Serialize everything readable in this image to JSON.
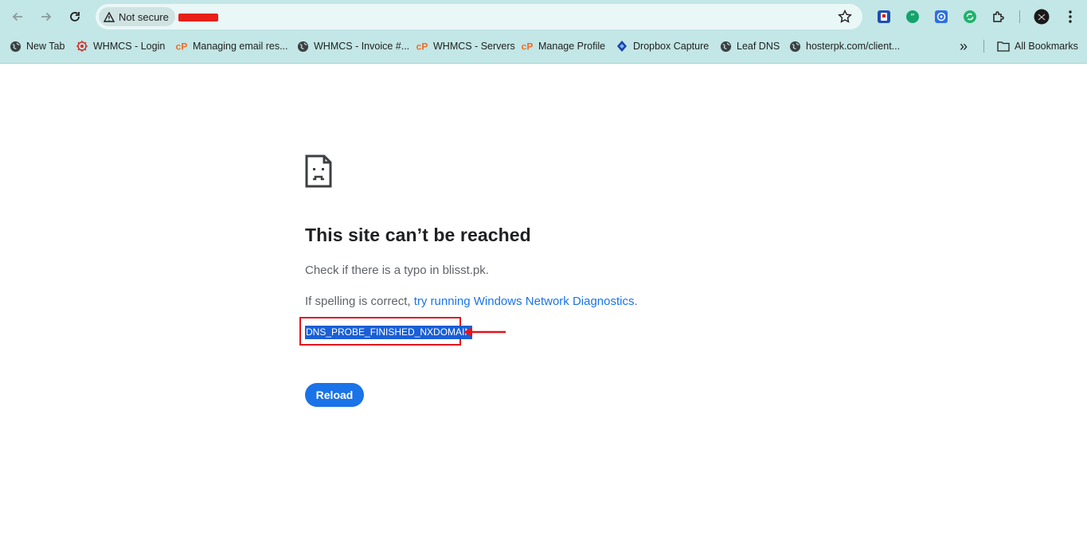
{
  "browser": {
    "security_chip": "Not secure",
    "bookmarks": [
      {
        "label": "New Tab",
        "icon": "globe-icon"
      },
      {
        "label": "WHMCS - Login",
        "icon": "whmcs-icon"
      },
      {
        "label": "Managing email res...",
        "icon": "cpanel-icon"
      },
      {
        "label": "WHMCS - Invoice #...",
        "icon": "globe-icon"
      },
      {
        "label": "WHMCS - Servers",
        "icon": "cpanel-icon"
      },
      {
        "label": "Manage Profile",
        "icon": "cpanel-icon"
      },
      {
        "label": "Dropbox Capture",
        "icon": "dropbox-icon"
      },
      {
        "label": "Leaf DNS",
        "icon": "globe-icon"
      },
      {
        "label": "hosterpk.com/client...",
        "icon": "globe-icon"
      }
    ],
    "all_bookmarks": "All Bookmarks",
    "overflow_glyph": "»"
  },
  "error_page": {
    "title": "This site can’t be reached",
    "typo_text": "Check if there is a typo in blisst.pk.",
    "spelling_prefix": "If spelling is correct, ",
    "diagnostics_link": "try running Windows Network Diagnostics",
    "spelling_suffix": ".",
    "error_code": "DNS_PROBE_FINISHED_NXDOMAIN",
    "reload_label": "Reload"
  },
  "colors": {
    "chrome_bg": "#c3e6e6",
    "accent": "#1a73e8",
    "annotation_red": "#e3141c"
  }
}
